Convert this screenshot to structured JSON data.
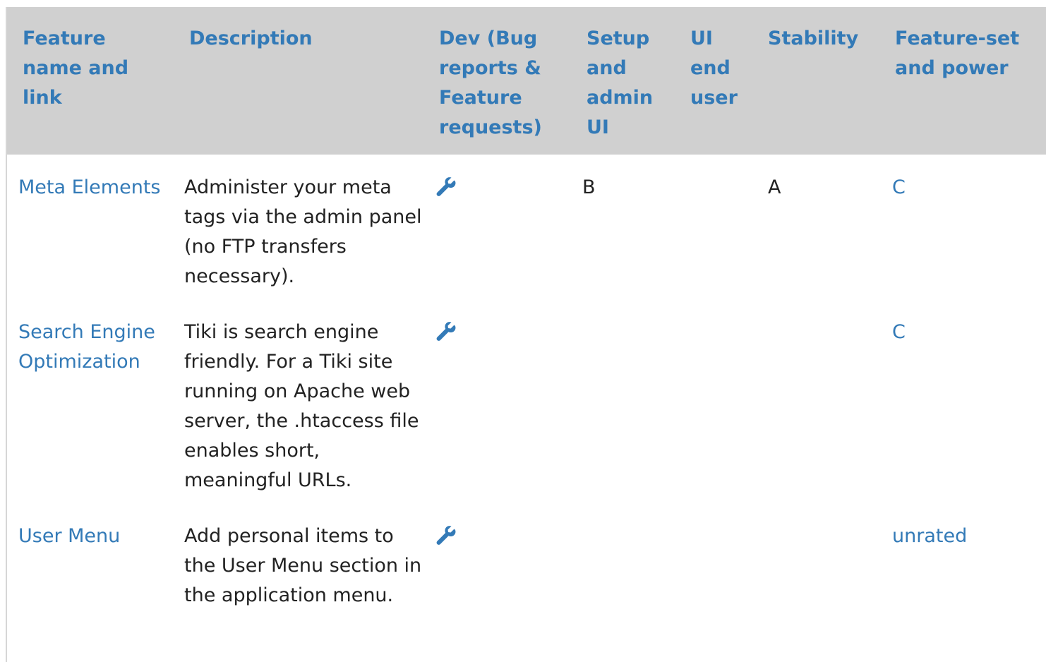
{
  "table": {
    "headers": {
      "name": "Feature name and link",
      "description": "Description",
      "dev": "Dev (Bug reports & Feature requests)",
      "setup": "Setup and admin UI",
      "ui": "UI end user",
      "stability": "Stability",
      "power": "Feature-set and power"
    },
    "rows": [
      {
        "name": "Meta Elements",
        "description": "Administer your meta tags via the admin panel (no FTP transfers necessary).",
        "dev_icon": "wrench-icon",
        "setup": "B",
        "ui": "",
        "stability": "A",
        "power": "C"
      },
      {
        "name": "Search Engine Optimization",
        "description": "Tiki is search engine friendly. For a Tiki site running on Apache web server, the .htaccess file enables short, meaningful URLs.",
        "dev_icon": "wrench-icon",
        "setup": "",
        "ui": "",
        "stability": "",
        "power": "C"
      },
      {
        "name": "User Menu",
        "description": "Add personal items to the User Menu section in the application menu.",
        "dev_icon": "wrench-icon",
        "setup": "",
        "ui": "",
        "stability": "",
        "power": "unrated"
      }
    ]
  },
  "colors": {
    "link": "#337ab7",
    "header_bg": "#d0d0d0",
    "text": "#222222"
  }
}
